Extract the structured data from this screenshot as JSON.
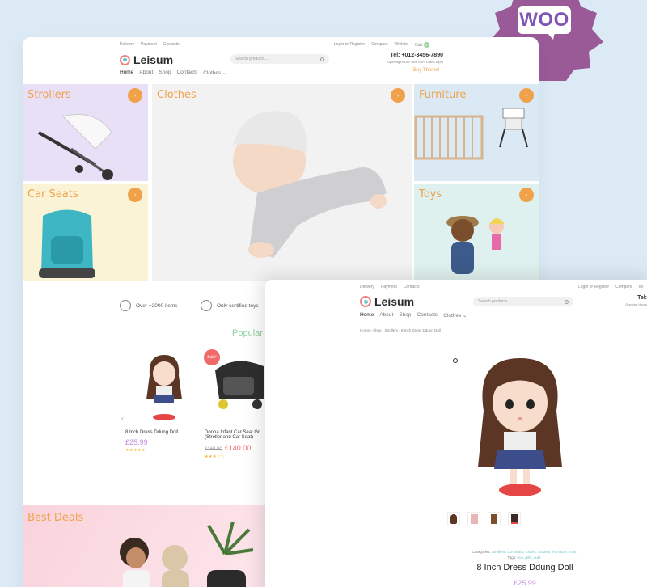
{
  "badge": {
    "text": "WOO"
  },
  "back_page": {
    "topbar_left": [
      "Delivery",
      "Payment",
      "Contacts"
    ],
    "topbar_right": [
      "Login",
      "or",
      "Register",
      "Compare",
      "Wishlist",
      "Cart",
      "0"
    ],
    "logo": "Leisum",
    "search_placeholder": "Search products...",
    "tel": "Tel: +012-3456-7890",
    "hours": "Opening Hours: Mon-Sun: 10am-10pm",
    "buy_theme": "Buy Theme!",
    "nav": [
      "Home",
      "About",
      "Shop",
      "Contacts",
      "Clothes"
    ],
    "tiles": {
      "strollers": "Strollers",
      "clothes": "Clothes",
      "furniture": "Furniture",
      "car_seats": "Car Seats",
      "toys": "Toys"
    },
    "features": [
      "Over +2000 items",
      "Only certified toys"
    ],
    "popular": "Popular",
    "products": [
      {
        "name": "8 Inch Dress Ddung Doll",
        "price": "£25.99",
        "stars": "★★★★★"
      },
      {
        "name": "Doona Infant Car Seat Gr",
        "name2": "(Stroller and Car Seat)",
        "old_price": "£160.00",
        "price": "£140.00",
        "stars": "★★★☆☆",
        "badge": "Sale!"
      }
    ],
    "best_deals": "Best Deals"
  },
  "front_page": {
    "topbar_left": [
      "Delivery",
      "Payment",
      "Contacts"
    ],
    "topbar_right": [
      "Login",
      "or",
      "Register",
      "Compare",
      "Wi"
    ],
    "logo": "Leisum",
    "search_placeholder": "Search products...",
    "tel": "Tel:",
    "hours": "Opening Hours",
    "nav": [
      "Home",
      "About",
      "Shop",
      "Contacts",
      "Clothes"
    ],
    "breadcrumb": "Home  ›  Shop  ›  Strollers  ›  8 Inch Dress Ddung Doll",
    "categories_label": "Categories:",
    "categories": "Strollers, Car Seats, Chairs, Clothes, Furniture, Toys",
    "tags_label": "Tags:",
    "tags": "eco, girls, cute",
    "product_title": "8 Inch Dress Ddung Doll",
    "product_price": "£25.99"
  },
  "colors": {
    "accent": "#f0a24a",
    "woo": "#7f54b3",
    "price": "#c28ce0",
    "sale": "#f06a6a",
    "teal": "#6cc3c8"
  }
}
